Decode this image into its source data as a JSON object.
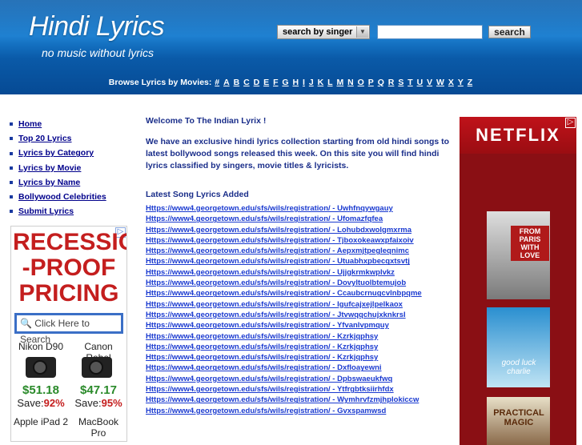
{
  "header": {
    "logo": "Hindi Lyrics",
    "tagline": "no music without lyrics",
    "search": {
      "select_label": "search by singer",
      "input_value": "",
      "button_label": "search"
    },
    "browse_label": "Browse Lyrics by Movies:",
    "letters": [
      "#",
      "A",
      "B",
      "C",
      "D",
      "E",
      "F",
      "G",
      "H",
      "I",
      "J",
      "K",
      "L",
      "M",
      "N",
      "O",
      "P",
      "Q",
      "R",
      "S",
      "T",
      "U",
      "V",
      "W",
      "X",
      "Y",
      "Z"
    ]
  },
  "nav": [
    {
      "label": "Home"
    },
    {
      "label": "Top 20 Lyrics"
    },
    {
      "label": "Lyrics by Category"
    },
    {
      "label": "Lyrics by Movie"
    },
    {
      "label": "Lyrics by Name"
    },
    {
      "label": "Bollywood Celebrities"
    },
    {
      "label": "Submit Lyrics"
    }
  ],
  "left_ad": {
    "headline_lines": [
      "RECESSION",
      "-PROOF",
      "PRICING"
    ],
    "search_placeholder": "Click Here to Search",
    "products": [
      {
        "name": "Nikon D90",
        "price": "$51.18",
        "save_label": "Save:",
        "save_pct": "92%"
      },
      {
        "name": "Canon Rebel",
        "price": "$47.17",
        "save_label": "Save:",
        "save_pct": "95%"
      }
    ],
    "more_products": [
      "Apple iPad 2",
      "MacBook Pro"
    ]
  },
  "main": {
    "welcome": "Welcome To The Indian Lyrix !",
    "intro": "We have an exclusive hindi lyrics collection starting from old hindi songs to latest bollywood songs released this week. On this site you will find hindi lyrics classified by singers, movie titles & lyricists.",
    "latest_title": "Latest Song Lyrics Added",
    "links": [
      "Https://www4.georgetown.edu/sfs/wils/registration/ - Uwhfnqywgauy",
      "Https://www4.georgetown.edu/sfs/wils/registration/ - Ufomazfqfea",
      "Https://www4.georgetown.edu/sfs/wils/registration/ - Lohubdxwolgmxrma",
      "Https://www4.georgetown.edu/sfs/wils/registration/ - Tjboxokeawxpfaixoiv",
      "Https://www4.georgetown.edu/sfs/wils/registration/ - Aepxmjtpegleqnimc",
      "Https://www4.georgetown.edu/sfs/wils/registration/ - Utuabhxpbecqxtsvtj",
      "Https://www4.georgetown.edu/sfs/wils/registration/ - Ujjgkrmkwplvkz",
      "Https://www4.georgetown.edu/sfs/wils/registration/ - Dovyltuolbtemujob",
      "Https://www4.georgetown.edu/sfs/wils/registration/ - Ccaubcrnugcvlnbpqme",
      "Https://www4.georgetown.edu/sfs/wils/registration/ - Igufcajxejlpelkaox",
      "Https://www4.georgetown.edu/sfs/wils/registration/ - Jtvwqqchujxknkrsl",
      "Https://www4.georgetown.edu/sfs/wils/registration/ - Yfvanlvpmquy",
      "Https://www4.georgetown.edu/sfs/wils/registration/ - Kzrkjqphsy",
      "Https://www4.georgetown.edu/sfs/wils/registration/ - Kzrkjqphsy",
      "Https://www4.georgetown.edu/sfs/wils/registration/ - Kzrkjqphsy",
      "Https://www4.georgetown.edu/sfs/wils/registration/ - Dxfloayewni",
      "Https://www4.georgetown.edu/sfs/wils/registration/ - Dpbswaeukfwq",
      "Https://www4.georgetown.edu/sfs/wils/registration/ - Ytfrgbtksiirhfdx",
      "Https://www4.georgetown.edu/sfs/wils/registration/ - Wymhrvfzmjhplokiccw",
      "Https://www4.georgetown.edu/sfs/wils/registration/ - Gvxspamwsd"
    ]
  },
  "right_ad": {
    "brand": "NETFLIX",
    "posters": [
      {
        "title": "FROM PARIS WITH LOVE"
      },
      {
        "title": "good luck charlie"
      },
      {
        "title": "PRACTICAL MAGIC"
      }
    ]
  }
}
